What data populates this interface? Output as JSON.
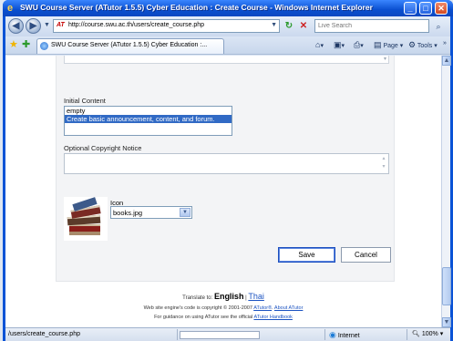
{
  "window": {
    "title": "SWU Course Server (ATutor 1.5.5) Cyber Education : Create Course - Windows Internet Explorer"
  },
  "toolbar": {
    "url": "http://course.swu.ac.th/users/create_course.php",
    "search_placeholder": "Live Search",
    "tab_title": "SWU Course Server (ATutor 1.5.5) Cyber Education :...",
    "page_label": "Page",
    "tools_label": "Tools"
  },
  "form": {
    "initial_content_label": "Initial Content",
    "initial_content_options": [
      {
        "label": "empty",
        "selected": false
      },
      {
        "label": "Create basic announcement, content, and forum.",
        "selected": true
      }
    ],
    "copyright_label": "Optional Copyright Notice",
    "copyright_value": "",
    "icon_label": "Icon",
    "icon_value": "books.jpg",
    "save_label": "Save",
    "cancel_label": "Cancel"
  },
  "footer": {
    "translate_prefix": "Translate to:",
    "lang_current": "English",
    "lang_sep": "|",
    "lang_other": "Thai",
    "copyright_text_a": "Web site engine's code is copyright © 2001-2007",
    "atutor_link": "ATutor®",
    "about_link": "About ATutor",
    "guidance_prefix": "For guidance on using ATutor see the official",
    "handbook_link": "ATutor Handbook"
  },
  "status": {
    "url": "/users/create_course.php",
    "zone": "Internet",
    "zoom": "100%"
  }
}
